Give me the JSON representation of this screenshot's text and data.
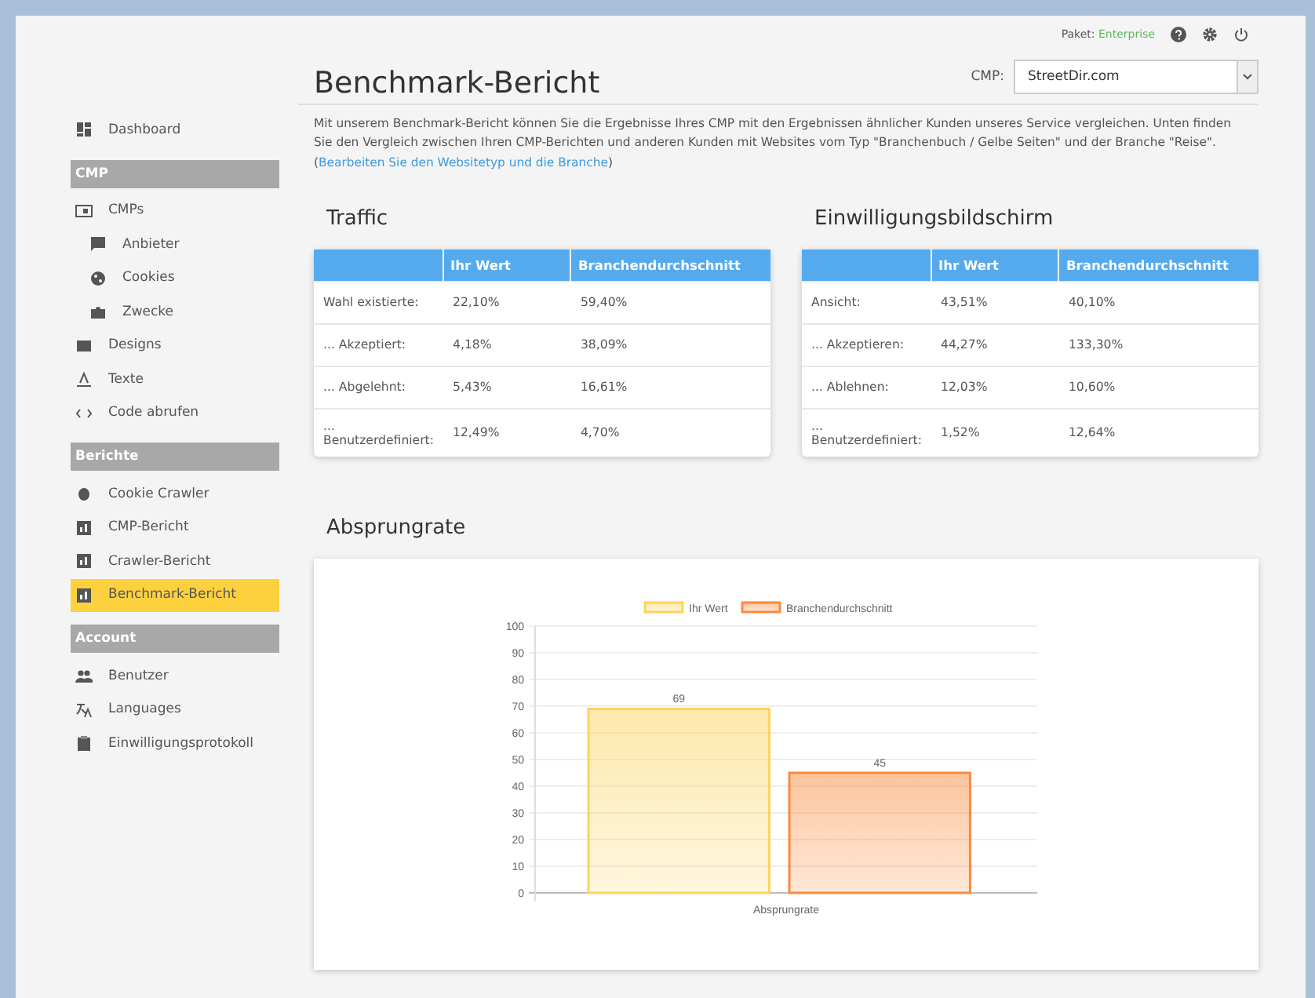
{
  "header": {
    "package_label": "Paket:",
    "package_value": "Enterprise"
  },
  "page": {
    "title": "Benchmark-Bericht",
    "cmp_label": "CMP:",
    "cmp_value": "StreetDir.com",
    "intro": "Mit unserem Benchmark-Bericht können Sie die Ergebnisse Ihres CMP mit den Ergebnissen ähnlicher Kunden unseres Service vergleichen. Unten finden Sie den Vergleich zwischen Ihren CMP-Berichten und anderen Kunden mit Websites vom Typ \"Branchenbuch / Gelbe Seiten\" und der Branche \"Reise\". (",
    "intro_link": "Bearbeiten Sie den Websitetyp und die Branche",
    "intro_end": ")"
  },
  "sidebar": {
    "items": [
      {
        "kind": "item",
        "label": "Dashboard",
        "selected": false
      },
      {
        "kind": "section",
        "label": "CMP"
      },
      {
        "kind": "item",
        "label": "CMPs",
        "selected": false
      },
      {
        "kind": "subitem",
        "label": "Anbieter",
        "selected": false
      },
      {
        "kind": "subitem",
        "label": "Cookies",
        "selected": false
      },
      {
        "kind": "subitem",
        "label": "Zwecke",
        "selected": false
      },
      {
        "kind": "item",
        "label": "Designs",
        "selected": false
      },
      {
        "kind": "item",
        "label": "Texte",
        "selected": false
      },
      {
        "kind": "item",
        "label": "Code abrufen",
        "selected": false
      },
      {
        "kind": "section",
        "label": "Berichte"
      },
      {
        "kind": "item",
        "label": "Cookie Crawler",
        "selected": false
      },
      {
        "kind": "item",
        "label": "CMP-Bericht",
        "selected": false
      },
      {
        "kind": "item",
        "label": "Crawler-Bericht",
        "selected": false
      },
      {
        "kind": "item",
        "label": "Benchmark-Bericht",
        "selected": true
      },
      {
        "kind": "section",
        "label": "Account"
      },
      {
        "kind": "item",
        "label": "Benutzer",
        "selected": false
      },
      {
        "kind": "item",
        "label": "Languages",
        "selected": false
      },
      {
        "kind": "item",
        "label": "Einwilligungsprotokoll",
        "selected": false
      }
    ]
  },
  "tables": [
    {
      "title": "Traffic",
      "columns": [
        "",
        "Ihr Wert",
        "Branchendurchschnitt"
      ],
      "rows": [
        [
          "Wahl existierte:",
          "22,10%",
          "59,40%"
        ],
        [
          "... Akzeptiert:",
          "4,18%",
          "38,09%"
        ],
        [
          "... Abgelehnt:",
          "5,43%",
          "16,61%"
        ],
        [
          "... Benutzerdefiniert:",
          "12,49%",
          "4,70%"
        ]
      ]
    },
    {
      "title": "Einwilligungsbildschirm",
      "columns": [
        "",
        "Ihr Wert",
        "Branchendurchschnitt"
      ],
      "rows": [
        [
          "Ansicht:",
          "43,51%",
          "40,10%"
        ],
        [
          "... Akzeptieren:",
          "44,27%",
          "133,30%"
        ],
        [
          "... Ablehnen:",
          "12,03%",
          "10,60%"
        ],
        [
          "... Benutzerdefiniert:",
          "1,52%",
          "12,64%"
        ]
      ]
    }
  ],
  "bounce": {
    "title": "Absprungrate",
    "chart_data": {
      "type": "bar",
      "categories": [
        "Absprungrate"
      ],
      "series": [
        {
          "name": "Ihr Wert",
          "color": "#fdd35a",
          "values": [
            69
          ]
        },
        {
          "name": "Branchendurchschnitt",
          "color": "#fb8a3c",
          "values": [
            45
          ]
        }
      ],
      "grid": true,
      "legend": true,
      "ylim": [
        0,
        100
      ],
      "yticks": [
        0,
        10,
        20,
        30,
        40,
        50,
        60,
        70,
        80,
        90,
        100
      ],
      "data_labels": true
    }
  }
}
